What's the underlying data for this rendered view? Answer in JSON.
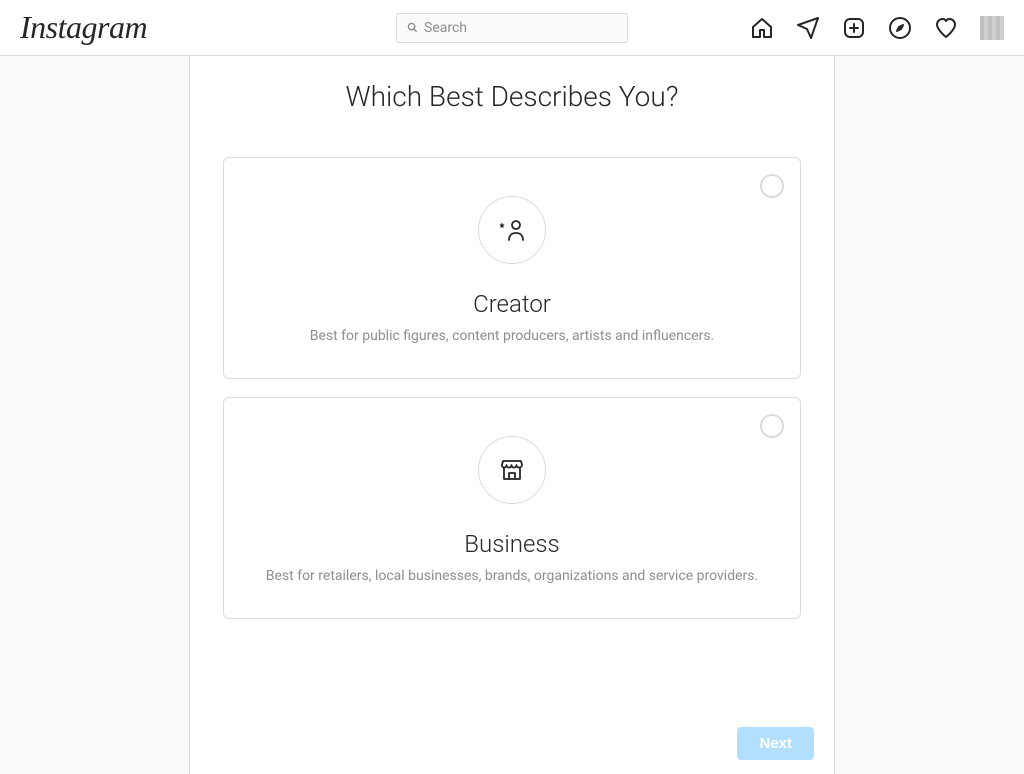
{
  "header": {
    "logo_text": "Instagram",
    "search_placeholder": "Search"
  },
  "page": {
    "title": "Which Best Describes You?",
    "options": [
      {
        "title": "Creator",
        "description": "Best for public figures, content producers, artists and influencers."
      },
      {
        "title": "Business",
        "description": "Best for retailers, local businesses, brands, organizations and service providers."
      }
    ],
    "next_label": "Next"
  }
}
